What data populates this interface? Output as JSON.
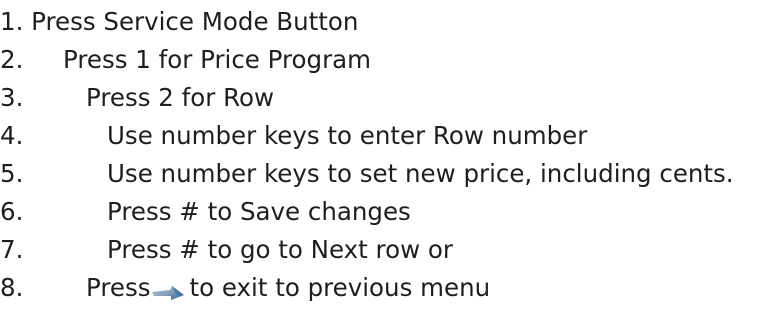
{
  "steps": [
    {
      "number": "1. Press Service Mode Button",
      "text": ""
    },
    {
      "number": "2.",
      "text": "Press 1 for Price Program"
    },
    {
      "number": "3.",
      "text": "Press 2 for Row"
    },
    {
      "number": "4.",
      "text": "Use number keys to enter Row number"
    },
    {
      "number": "5.",
      "text": "Use number keys to set new price, including cents."
    },
    {
      "number": "6.",
      "text": "Press # to Save changes"
    },
    {
      "number": "7.",
      "text": "Press # to go to Next row or"
    },
    {
      "number": "8.",
      "text_before": "Press",
      "icon": "exit-arrow-icon",
      "text_after": "to exit to previous menu"
    }
  ]
}
